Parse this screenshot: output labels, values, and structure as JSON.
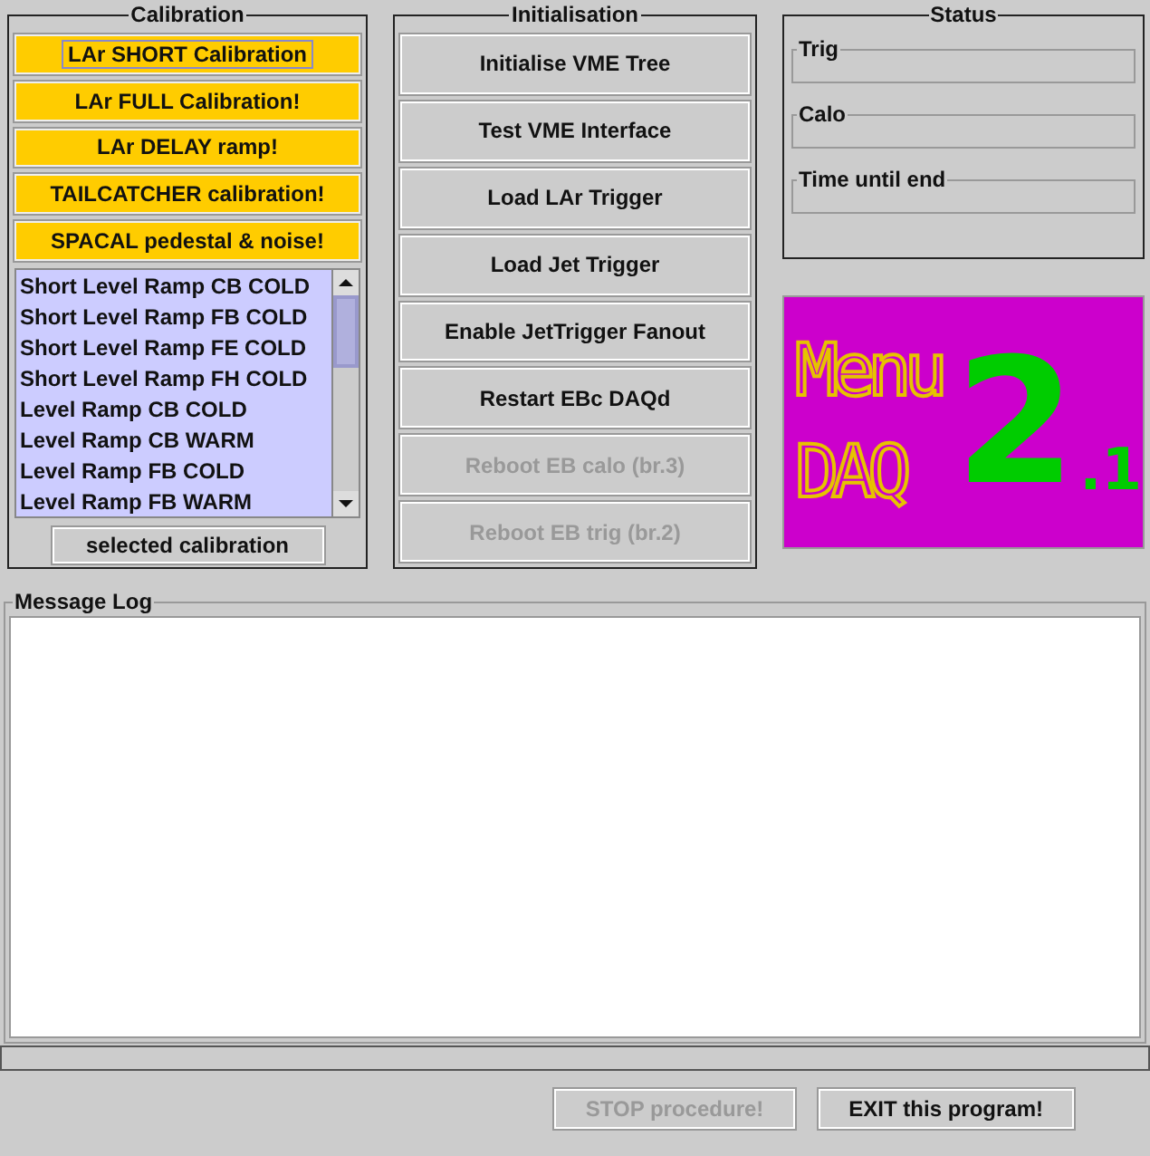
{
  "calibration": {
    "title": "Calibration",
    "buttons": [
      {
        "label": "LAr SHORT Calibration",
        "focused": true
      },
      {
        "label": "LAr FULL Calibration!",
        "focused": false
      },
      {
        "label": "LAr DELAY ramp!",
        "focused": false
      },
      {
        "label": "TAILCATCHER calibration!",
        "focused": false
      },
      {
        "label": "SPACAL pedestal & noise!",
        "focused": false
      }
    ],
    "list": [
      "Short Level Ramp CB COLD",
      "Short Level Ramp FB COLD",
      "Short Level Ramp FE COLD",
      "Short Level Ramp FH COLD",
      "Level Ramp CB COLD",
      "Level Ramp CB WARM",
      "Level Ramp FB COLD",
      "Level Ramp FB WARM"
    ],
    "run_button": "selected calibration"
  },
  "initialisation": {
    "title": "Initialisation",
    "buttons": [
      {
        "label": "Initialise VME Tree",
        "disabled": false
      },
      {
        "label": "Test VME Interface",
        "disabled": false
      },
      {
        "label": "Load LAr Trigger",
        "disabled": false
      },
      {
        "label": "Load Jet Trigger",
        "disabled": false
      },
      {
        "label": "Enable JetTrigger Fanout",
        "disabled": false
      },
      {
        "label": "Restart EBc DAQd",
        "disabled": false
      },
      {
        "label": "Reboot EB calo (br.3)",
        "disabled": true
      },
      {
        "label": "Reboot EB trig (br.2)",
        "disabled": true
      }
    ]
  },
  "status": {
    "title": "Status",
    "fields": [
      "Trig",
      "Calo",
      "Time until end"
    ]
  },
  "logo": {
    "word1": "Menu",
    "word2": "DAQ",
    "version": "2",
    "minor": ".1"
  },
  "message_log": {
    "title": "Message Log"
  },
  "footer_buttons": [
    {
      "label": "STOP procedure!",
      "disabled": true
    },
    {
      "label": "EXIT this program!",
      "disabled": false
    }
  ]
}
